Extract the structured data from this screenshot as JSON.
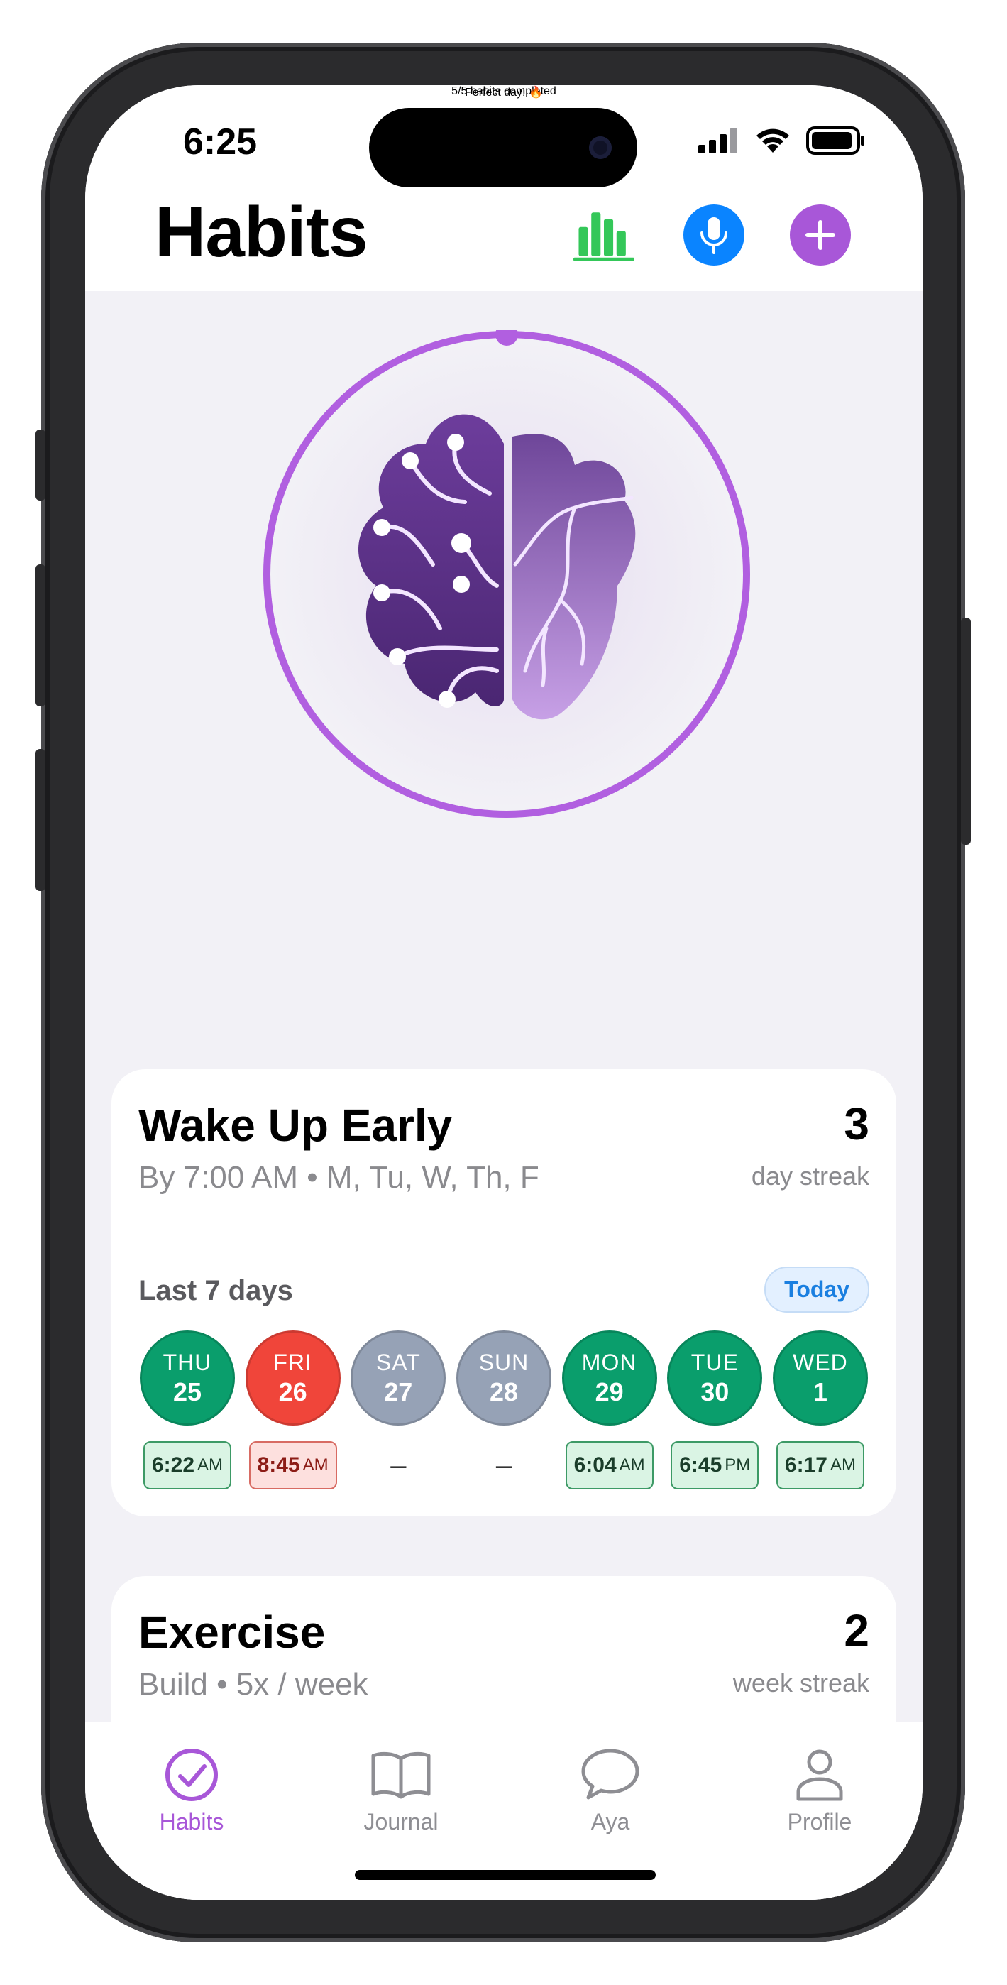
{
  "status": {
    "time": "6:25"
  },
  "header": {
    "title": "Habits",
    "icons": [
      "stats-bar-chart-icon",
      "microphone-icon",
      "plus-icon"
    ],
    "colors": {
      "stats": "#34c759",
      "mic": "#0a84ff",
      "add": "#a857d8"
    }
  },
  "progress": {
    "completed": 5,
    "total": 5
  },
  "summary": {
    "completed_text": "5/5 habits completed",
    "message": "Perfect day! 🔥"
  },
  "habits": [
    {
      "name": "Wake Up Early",
      "subtitle": "By 7:00 AM • M, Tu, W, Th, F",
      "streak_value": "3",
      "streak_label": "day streak",
      "history_title": "Last 7 days",
      "today_label": "Today",
      "days": [
        {
          "dow": "THU",
          "date": "25",
          "status": "done",
          "time": "6:22",
          "ampm": "AM"
        },
        {
          "dow": "FRI",
          "date": "26",
          "status": "missed",
          "time": "8:45",
          "ampm": "AM"
        },
        {
          "dow": "SAT",
          "date": "27",
          "status": "off",
          "time": "–",
          "ampm": ""
        },
        {
          "dow": "SUN",
          "date": "28",
          "status": "off",
          "time": "–",
          "ampm": ""
        },
        {
          "dow": "MON",
          "date": "29",
          "status": "done",
          "time": "6:04",
          "ampm": "AM"
        },
        {
          "dow": "TUE",
          "date": "30",
          "status": "done",
          "time": "6:45",
          "ampm": "PM"
        },
        {
          "dow": "WED",
          "date": "1",
          "status": "done",
          "time": "6:17",
          "ampm": "AM"
        }
      ]
    },
    {
      "name": "Exercise",
      "subtitle": "Build • 5x / week",
      "streak_value": "2",
      "streak_label": "week streak"
    }
  ],
  "tabs": [
    {
      "label": "Habits",
      "icon": "checkmark-circle-icon",
      "active": true
    },
    {
      "label": "Journal",
      "icon": "book-icon",
      "active": false
    },
    {
      "label": "Aya",
      "icon": "chat-bubble-icon",
      "active": false
    },
    {
      "label": "Profile",
      "icon": "person-icon",
      "active": false
    }
  ],
  "status_colors": {
    "done": "#0a9e6c",
    "missed": "#f0453a",
    "off": "#96a2b6"
  }
}
